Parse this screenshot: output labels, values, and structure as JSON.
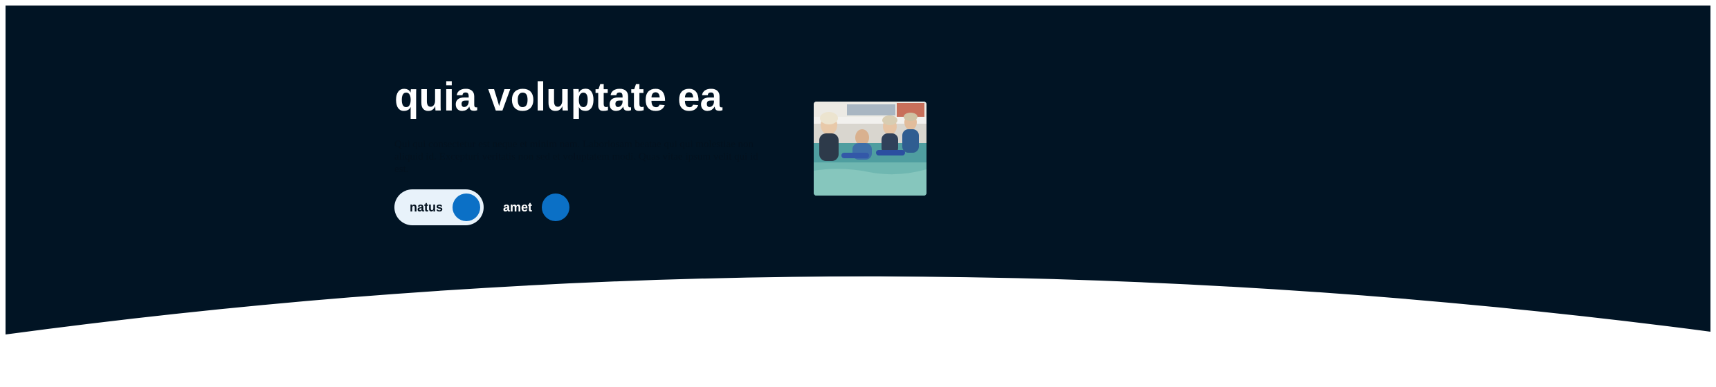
{
  "hero": {
    "title": "quia voluptate ea",
    "body": "Qui qui consectetur est neque et minim nam. Laboriosam beatae qui qui molestiae non aliquid id. Excepturi veritatis non sed et voluptatem modi. Quas vitae ipsum velit qui id est.",
    "primary_button": {
      "label": "natus",
      "icon": "circle-icon"
    },
    "secondary_button": {
      "label": "amet",
      "icon": "circle-icon"
    }
  },
  "colors": {
    "hero_background": "#011424",
    "accent": "#0b70c6",
    "button_light": "#e8f2fa",
    "page_background": "#ffffff"
  }
}
